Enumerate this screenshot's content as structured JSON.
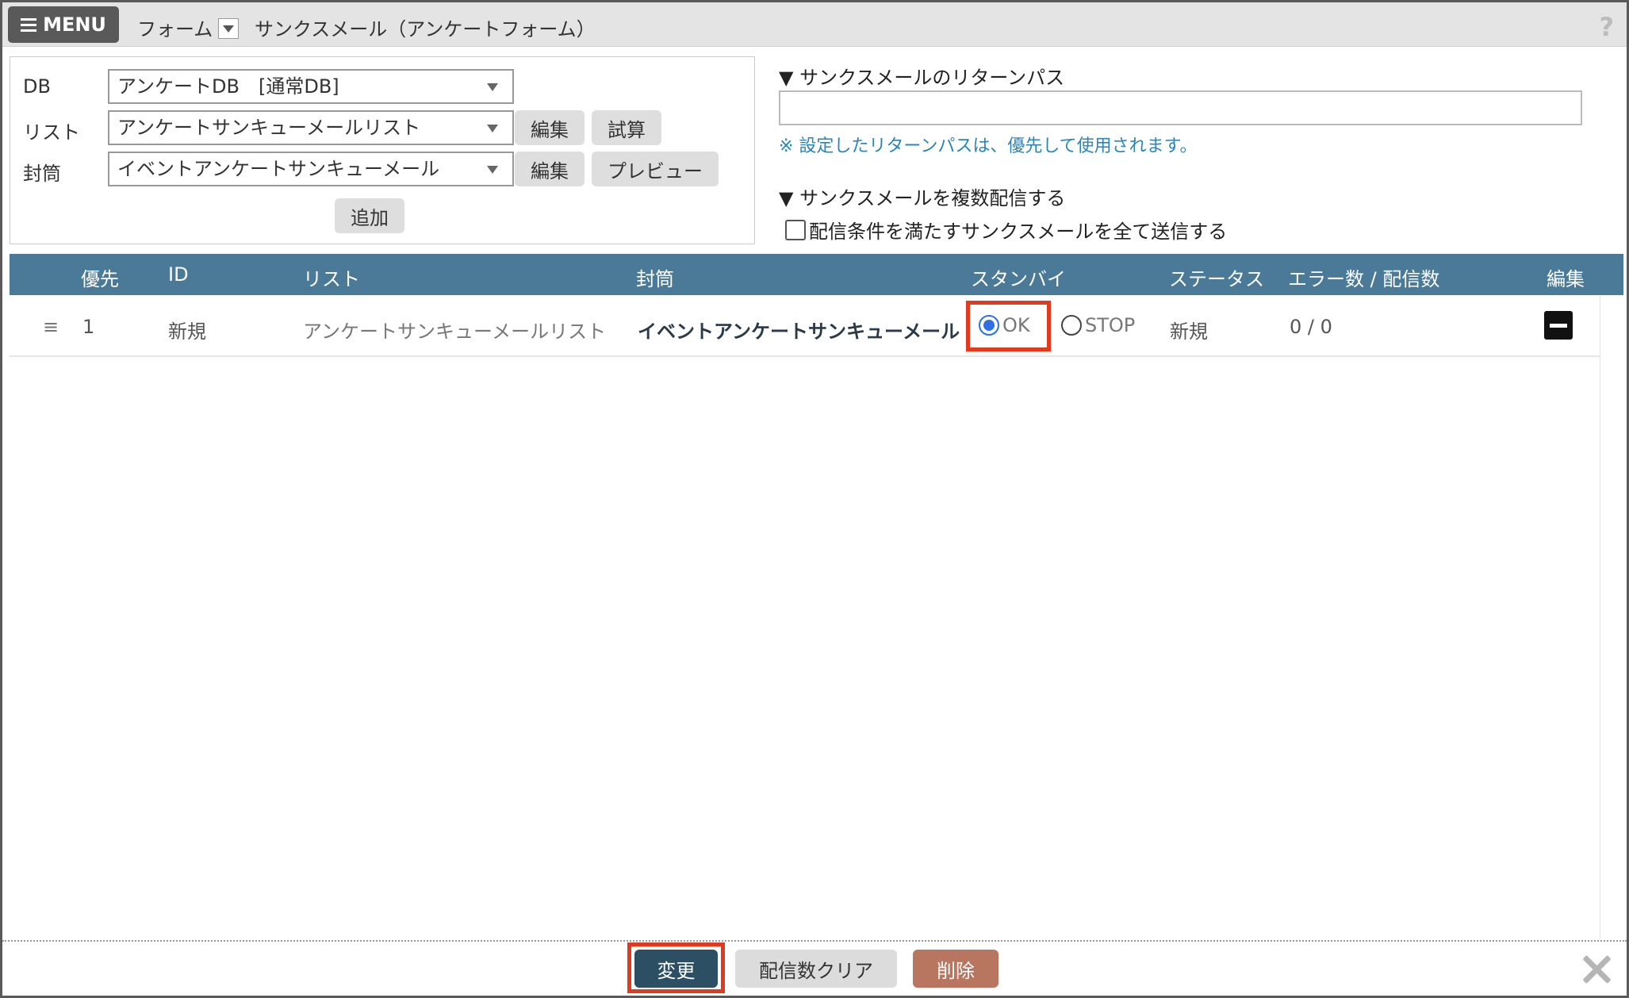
{
  "header": {
    "menu_label": "MENU",
    "breadcrumb": "フォーム",
    "page_title": "サンクスメール（アンケートフォーム）",
    "help": "?"
  },
  "form": {
    "db_label": "DB",
    "db_value": "アンケートDB　[通常DB]",
    "list_label": "リスト",
    "list_value": "アンケートサンキューメールリスト",
    "envelope_label": "封筒",
    "envelope_value": "イベントアンケートサンキューメール",
    "edit_label": "編集",
    "trial_label": "試算",
    "preview_label": "プレビュー",
    "add_label": "追加"
  },
  "return_path": {
    "heading": "▼ サンクスメールのリターンパス",
    "value": "",
    "note": "※ 設定したリターンパスは、優先して使用されます。"
  },
  "multi": {
    "heading": "▼ サンクスメールを複数配信する",
    "checkbox_label": "配信条件を満たすサンクスメールを全て送信する",
    "checked": false
  },
  "table": {
    "headers": {
      "priority": "優先",
      "id": "ID",
      "list": "リスト",
      "envelope": "封筒",
      "standby": "スタンバイ",
      "status": "ステータス",
      "counts": "エラー数 / 配信数",
      "edit": "編集"
    },
    "rows": [
      {
        "handle": "≡",
        "priority": "1",
        "id": "新規",
        "list": "アンケートサンキューメールリスト",
        "envelope": "イベントアンケートサンキューメール",
        "standby_ok": "OK",
        "standby_stop": "STOP",
        "selected": "OK",
        "status": "新規",
        "counts": "0 / 0"
      }
    ]
  },
  "footer": {
    "change_label": "変更",
    "clear_label": "配信数クリア",
    "delete_label": "削除"
  },
  "colors": {
    "table_header": "#4b7a98",
    "highlight": "#e23a1e",
    "change_button": "#2c4f63",
    "delete_button": "#b87560",
    "note_text": "#2a86b8",
    "radio_selected": "#2f6fe4"
  }
}
